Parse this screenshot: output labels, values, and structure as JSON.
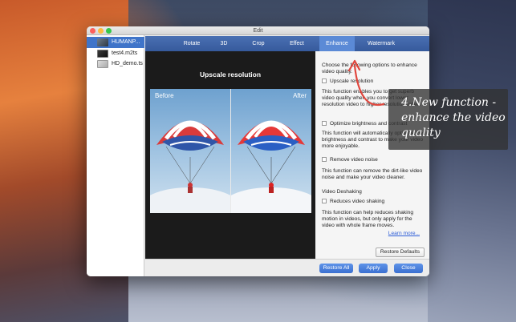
{
  "window": {
    "title": "Edit"
  },
  "files": [
    {
      "name": "HUMANP...",
      "selected": true
    },
    {
      "name": "test4.m2ts",
      "selected": false
    },
    {
      "name": "HD_demo.ts",
      "selected": false
    }
  ],
  "tabs": [
    "Rotate",
    "3D",
    "Crop",
    "Effect",
    "Enhance",
    "Watermark"
  ],
  "active_tab": "Enhance",
  "preview": {
    "title": "Upscale resolution",
    "before_label": "Before",
    "after_label": "After"
  },
  "options": {
    "intro": "Choose the following options to enhance video quality.",
    "upscale": {
      "label": "Upscale resolution",
      "checked": false,
      "description": "This function enables you to get superb video quality when you convert lower resolution video to higher resolution video."
    },
    "brightness": {
      "label": "Optimize brightness and contrast",
      "checked": false,
      "description": "This function will automatically optimize the brightness and contrast to make your video more enjoyable."
    },
    "noise": {
      "label": "Remove video noise",
      "checked": false,
      "description": "This function can remove the dirt-like video noise and make your video cleaner."
    },
    "deshaking": {
      "section_title": "Video Deshaking",
      "label": "Reduces video shaking",
      "checked": false,
      "description": "This function can help reduces shaking motion in videos, but only apply for the video with whole frame moves."
    },
    "learn_more": "Learn more...",
    "restore_defaults": "Restore Defaults"
  },
  "footer": {
    "restore_all": "Restore All",
    "apply": "Apply",
    "close": "Close"
  },
  "callout": {
    "text": "4.New function - enhance the video quality"
  },
  "colors": {
    "tab_bar": "#3f66aa",
    "tab_active": "#5b8ad6",
    "selection": "#3f74c9",
    "button": "#4a7fdc",
    "annotation_arrow": "#e0473e"
  }
}
